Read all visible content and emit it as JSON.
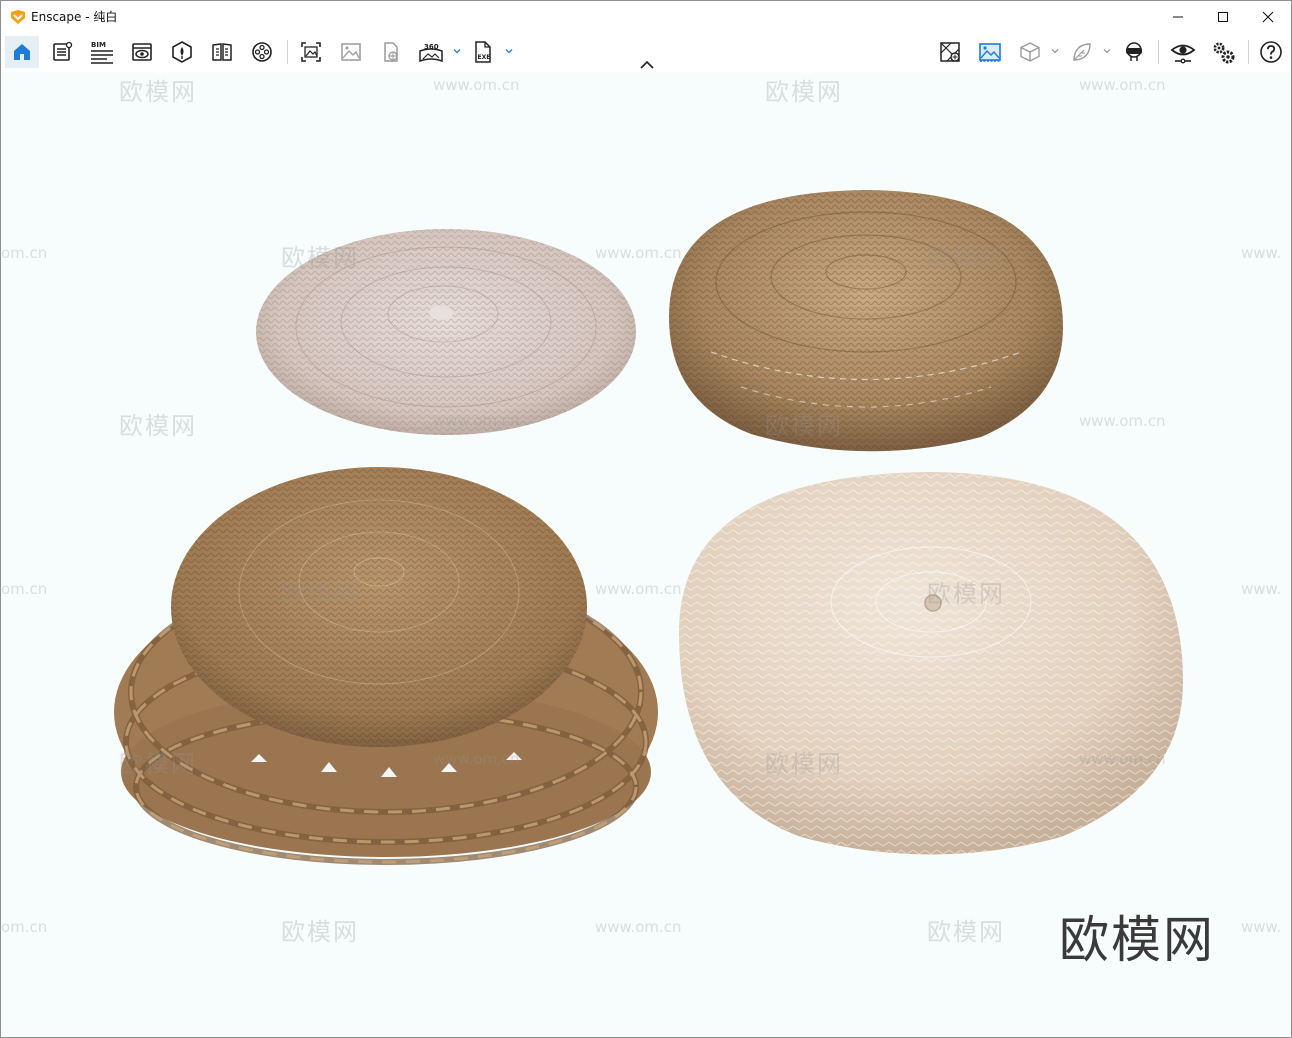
{
  "window": {
    "app_title": "Enscape - 纯白"
  },
  "titlebar": {
    "minimize_icon": "minimize-icon",
    "maximize_icon": "maximize-icon",
    "close_icon": "close-icon"
  },
  "toolbar": {
    "left_items": [
      {
        "name": "home-icon",
        "active": true
      },
      {
        "name": "notes-icon"
      },
      {
        "name": "bim-icon",
        "label": "BIM"
      },
      {
        "name": "view-management-icon"
      },
      {
        "name": "asset-library-icon"
      },
      {
        "name": "material-editor-icon"
      },
      {
        "name": "video-editor-icon"
      },
      {
        "name": "screenshot-icon"
      },
      {
        "name": "batch-render-icon"
      },
      {
        "name": "web-standalone-icon"
      },
      {
        "name": "panorama-icon",
        "label": "360"
      },
      {
        "name": "exe-export-icon",
        "label": "EXE"
      }
    ],
    "right_items": [
      {
        "name": "visual-settings-icon"
      },
      {
        "name": "background-image-icon"
      },
      {
        "name": "orthographic-icon"
      },
      {
        "name": "render-quality-icon"
      },
      {
        "name": "vr-headset-icon"
      },
      {
        "name": "view-mode-icon"
      },
      {
        "name": "settings-icon"
      },
      {
        "name": "help-icon"
      }
    ]
  },
  "viewport": {
    "watermark_cn": "欧模网",
    "watermark_url": "www.om.cn",
    "watermark_url_cut": "om.cn",
    "watermark_url_cut2": "www.",
    "brand_text": "欧模网"
  },
  "colors": {
    "accent": "#1e7bd6",
    "viewport_bg": "#f7fcfc",
    "cushion_light": "#d8c8c0",
    "cushion_straw": "#b08f6a",
    "cushion_wicker": "#a9855e",
    "cushion_cream": "#e6d6c6"
  }
}
